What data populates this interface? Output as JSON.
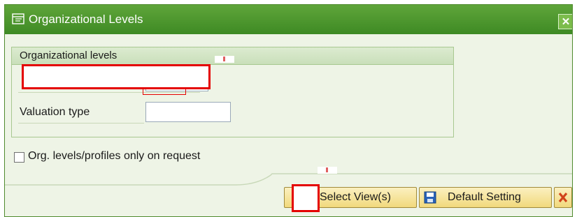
{
  "window": {
    "title": "Organizational Levels",
    "close_icon": "close-icon"
  },
  "group": {
    "header": "Organizational levels",
    "fields": [
      {
        "label": "",
        "value": ""
      },
      {
        "label": "Valuation type",
        "value": ""
      }
    ]
  },
  "checkbox": {
    "label": "Org. levels/profiles only on request",
    "checked": false
  },
  "buttons": {
    "select_views": "Select View(s)",
    "default_setting": "Default Setting"
  },
  "colors": {
    "titlebar": "#4a962d",
    "highlight": "#e40000",
    "button_face": "#f4df8e"
  }
}
